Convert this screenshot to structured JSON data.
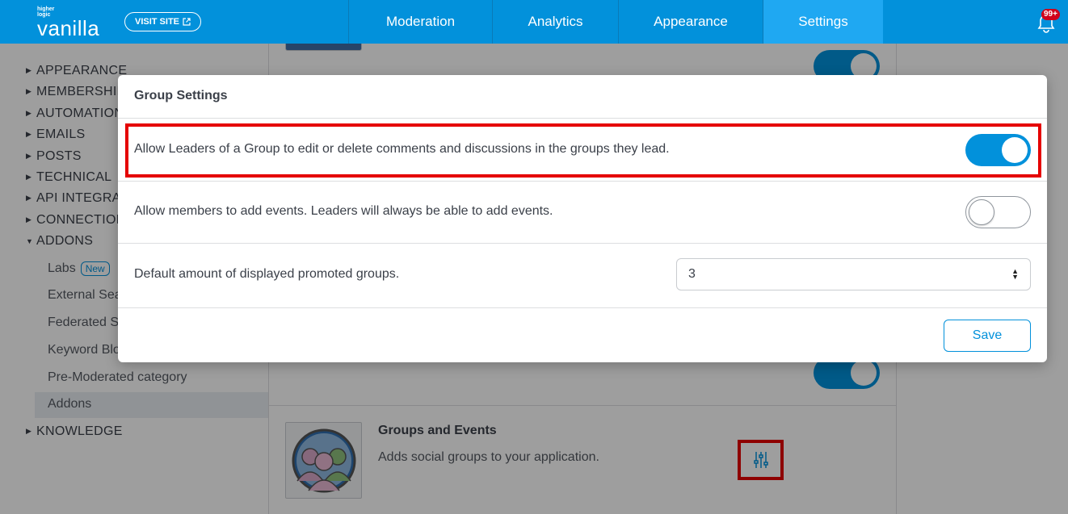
{
  "header": {
    "logo_small": "higher logic",
    "logo_big": "vanilla",
    "visit_site": "VISIT SITE",
    "nav": [
      {
        "label": "Moderation"
      },
      {
        "label": "Analytics"
      },
      {
        "label": "Appearance"
      },
      {
        "label": "Settings",
        "active": true
      }
    ],
    "notification_count": "99+"
  },
  "sidebar": {
    "sections": [
      {
        "label": "APPEARANCE"
      },
      {
        "label": "MEMBERSHIP"
      },
      {
        "label": "AUTOMATION"
      },
      {
        "label": "EMAILS"
      },
      {
        "label": "POSTS"
      },
      {
        "label": "TECHNICAL"
      },
      {
        "label": "API INTEGRAT"
      },
      {
        "label": "CONNECTION"
      },
      {
        "label": "ADDONS"
      }
    ],
    "addons_items": [
      {
        "label": "Labs",
        "badge": "New"
      },
      {
        "label": "External Sea"
      },
      {
        "label": "Federated S"
      },
      {
        "label": "Keyword Blo"
      },
      {
        "label": "Pre-Moderated category"
      },
      {
        "label": "Addons",
        "active": true
      }
    ],
    "last_section": "KNOWLEDGE"
  },
  "addon": {
    "title": "Groups and Events",
    "description": "Adds social groups to your application."
  },
  "modal": {
    "title": "Group Settings",
    "setting_leaders_edit": {
      "label": "Allow Leaders of a Group to edit or delete comments and discussions in the groups they lead.",
      "enabled": true
    },
    "setting_members_events": {
      "label": "Allow members to add events. Leaders will always be able to add events.",
      "enabled": false
    },
    "setting_promoted": {
      "label": "Default amount of displayed promoted groups.",
      "value": "3"
    },
    "save_label": "Save"
  },
  "colors": {
    "brand": "#0291db",
    "highlight": "#e50000"
  }
}
